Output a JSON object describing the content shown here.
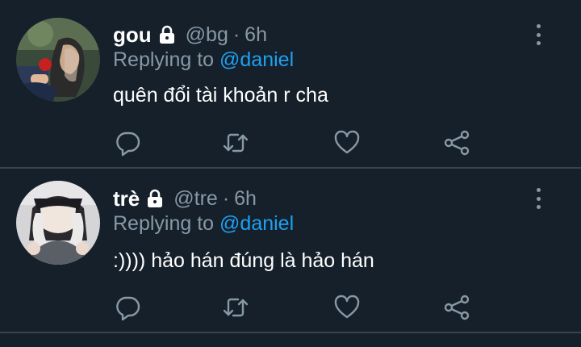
{
  "colors": {
    "background": "#15202b",
    "divider": "#38444d",
    "primary_text": "#ffffff",
    "secondary_text": "#8899a6",
    "accent": "#1da1f2"
  },
  "tweets": [
    {
      "display_name": "gou",
      "handle": "@bg",
      "separator": "·",
      "time": "6h",
      "replying_prefix": "Replying to",
      "replying_mention": "@daniel",
      "text": "quên đổi tài khoản r cha",
      "icons": [
        "lock-icon",
        "more-vertical-icon",
        "reply-icon",
        "retweet-icon",
        "like-icon",
        "share-icon"
      ]
    },
    {
      "display_name": "trè",
      "handle": "@tre",
      "separator": "·",
      "time": "6h",
      "replying_prefix": "Replying to",
      "replying_mention": "@daniel",
      "text": ":)))) hảo hán đúng là hảo hán",
      "icons": [
        "lock-icon",
        "more-vertical-icon",
        "reply-icon",
        "retweet-icon",
        "like-icon",
        "share-icon"
      ]
    }
  ]
}
